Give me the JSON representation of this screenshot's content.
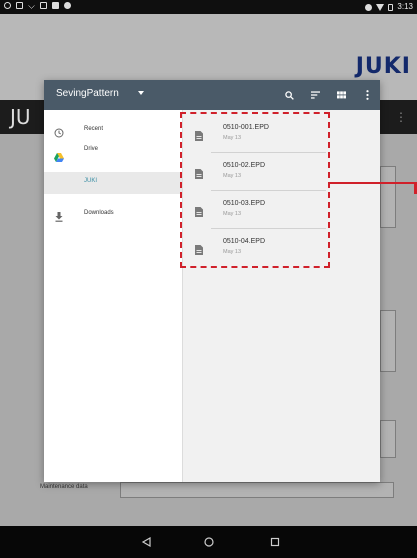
{
  "status_bar": {
    "time": "3:13"
  },
  "app": {
    "logo": "JUKI",
    "title_partial": "JU"
  },
  "background": {
    "maintenance_label": "Maintenance data"
  },
  "dialog": {
    "title": "SevingPattern",
    "header_color": "#4a5a68",
    "actions": [
      "search-icon",
      "sort-icon",
      "grid-view-icon",
      "more-vert-icon"
    ]
  },
  "drawer": {
    "items": [
      {
        "label": "Recent",
        "icon": "clock-icon"
      },
      {
        "label": "Drive",
        "icon": "drive-icon"
      },
      {
        "label": "JUKI",
        "icon": "",
        "selected": true
      },
      {
        "label": "Downloads",
        "icon": "download-icon"
      }
    ]
  },
  "files": [
    {
      "name": "0510-001.EPD",
      "date": "May 13"
    },
    {
      "name": "0510-02.EPD",
      "date": "May 13"
    },
    {
      "name": "0510-03.EPD",
      "date": "May 13"
    },
    {
      "name": "0510-04.EPD",
      "date": "May 13"
    }
  ],
  "annotation": {
    "color": "#d0202a"
  },
  "nav_bar": {
    "buttons": [
      "back-icon",
      "home-icon",
      "recents-icon"
    ]
  }
}
